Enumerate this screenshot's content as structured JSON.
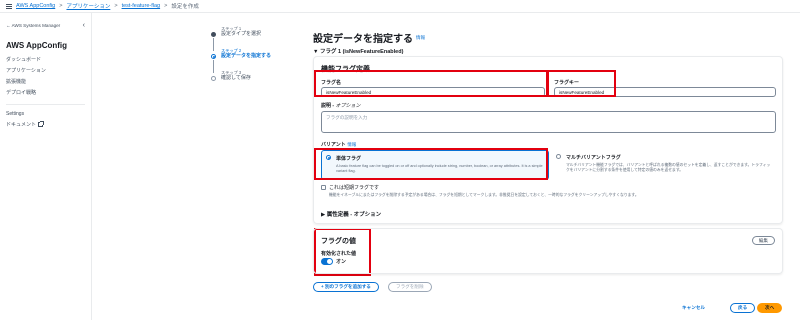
{
  "breadcrumb": {
    "items": [
      "AWS AppConfig",
      "アプリケーション",
      "test-feature-flag"
    ],
    "current": "設定を作成",
    "separator": ">"
  },
  "sidebar": {
    "top_label": "← AWS Systems Manager",
    "close": "‹",
    "title": "AWS AppConfig",
    "items": [
      "ダッシュボード",
      "アプリケーション",
      "拡張機能",
      "デプロイ戦略"
    ],
    "settings": "Settings",
    "docs": "ドキュメント"
  },
  "steps": [
    {
      "num": "ステップ 1",
      "label": "設定タイプを選択"
    },
    {
      "num": "ステップ 2",
      "label": "設定データを指定する"
    },
    {
      "num": "ステップ 3",
      "label": "確認して保存"
    }
  ],
  "header": {
    "title": "設定データを指定する",
    "info": "情報",
    "flag_section": "▼ フラグ 1 (isNewFeatureEnabled)"
  },
  "definition": {
    "title": "機能フラグ定義",
    "flag_name_label": "フラグ名",
    "flag_name_value": "isNewFeatureEnabled",
    "flag_key_label": "フラグキー",
    "flag_key_value": "isNewFeatureEnabled",
    "desc_label": "説明 - ",
    "desc_optional": "オプション",
    "desc_placeholder": "フラグの説明を入力",
    "variant_label": "バリアント",
    "variant_info": "情報",
    "single_title": "単体フラグ",
    "single_desc": "A basic feature flag can be toggled on or off and optionally include string, number, boolean, or array attributes. It is a simple variant flag.",
    "multi_title": "マルチバリアントフラグ",
    "multi_desc": "マルチバリアント機能フラグでは、バリアントと呼ばれる複数の値のセットを定義し、返すことができます。トラフィックをバリアントに分割する条件を使用して特定の値のみを返せます。",
    "shortterm_title": "これは短期フラグです",
    "shortterm_desc": "機能をイネーブルにまたはフラグを削除する予定がある場合は、フラグを短期としてマークします。非推奨日を設定しておくと、一時的なフラグをクリーンアップしやすくなります。",
    "attributes_expander": "▶ 属性定義 - オプション"
  },
  "flag_value": {
    "title": "フラグの値",
    "edit": "編集",
    "enabled_label": "有効化された値",
    "toggle_text": "オン"
  },
  "actions": {
    "add_flag": "+ 別のフラグを追加する",
    "remove_flag": "フラグを削除",
    "cancel": "キャンセル",
    "back": "戻る",
    "next": "次へ"
  },
  "colors": {
    "accent": "#0972d3",
    "highlight": "#e3000f",
    "primary_button": "#ff9900"
  }
}
